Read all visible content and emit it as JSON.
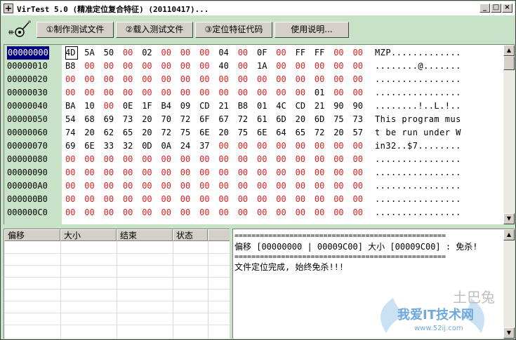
{
  "window": {
    "title": "VirTest 5.0 (精准定位复合特征) (20110417)..."
  },
  "toolbar": {
    "buttons": [
      "①制作测试文件",
      "②载入测试文件",
      "③定位特征代码",
      "使用说明..."
    ]
  },
  "hex": {
    "rows": [
      {
        "addr": "00000000",
        "bytes": [
          "4D",
          "5A",
          "50",
          "00",
          "02",
          "00",
          "00",
          "00",
          "04",
          "00",
          "0F",
          "00",
          "FF",
          "FF",
          "00",
          "00"
        ],
        "ascii": "MZP............."
      },
      {
        "addr": "00000010",
        "bytes": [
          "B8",
          "00",
          "00",
          "00",
          "00",
          "00",
          "00",
          "00",
          "40",
          "00",
          "1A",
          "00",
          "00",
          "00",
          "00",
          "00"
        ],
        "ascii": "........@......."
      },
      {
        "addr": "00000020",
        "bytes": [
          "00",
          "00",
          "00",
          "00",
          "00",
          "00",
          "00",
          "00",
          "00",
          "00",
          "00",
          "00",
          "00",
          "00",
          "00",
          "00"
        ],
        "ascii": "................"
      },
      {
        "addr": "00000030",
        "bytes": [
          "00",
          "00",
          "00",
          "00",
          "00",
          "00",
          "00",
          "00",
          "00",
          "00",
          "00",
          "00",
          "00",
          "01",
          "00",
          "00"
        ],
        "ascii": "................"
      },
      {
        "addr": "00000040",
        "bytes": [
          "BA",
          "10",
          "00",
          "0E",
          "1F",
          "B4",
          "09",
          "CD",
          "21",
          "B8",
          "01",
          "4C",
          "CD",
          "21",
          "90",
          "90"
        ],
        "ascii": "........!..L.!.."
      },
      {
        "addr": "00000050",
        "bytes": [
          "54",
          "68",
          "69",
          "73",
          "20",
          "70",
          "72",
          "6F",
          "67",
          "72",
          "61",
          "6D",
          "20",
          "6D",
          "75",
          "73"
        ],
        "ascii": "This program mus"
      },
      {
        "addr": "00000060",
        "bytes": [
          "74",
          "20",
          "62",
          "65",
          "20",
          "72",
          "75",
          "6E",
          "20",
          "75",
          "6E",
          "64",
          "65",
          "72",
          "20",
          "57"
        ],
        "ascii": "t be run under W"
      },
      {
        "addr": "00000070",
        "bytes": [
          "69",
          "6E",
          "33",
          "32",
          "0D",
          "0A",
          "24",
          "37",
          "00",
          "00",
          "00",
          "00",
          "00",
          "00",
          "00",
          "00"
        ],
        "ascii": "in32..$7........"
      },
      {
        "addr": "00000080",
        "bytes": [
          "00",
          "00",
          "00",
          "00",
          "00",
          "00",
          "00",
          "00",
          "00",
          "00",
          "00",
          "00",
          "00",
          "00",
          "00",
          "00"
        ],
        "ascii": "................"
      },
      {
        "addr": "00000090",
        "bytes": [
          "00",
          "00",
          "00",
          "00",
          "00",
          "00",
          "00",
          "00",
          "00",
          "00",
          "00",
          "00",
          "00",
          "00",
          "00",
          "00"
        ],
        "ascii": "................"
      },
      {
        "addr": "000000A0",
        "bytes": [
          "00",
          "00",
          "00",
          "00",
          "00",
          "00",
          "00",
          "00",
          "00",
          "00",
          "00",
          "00",
          "00",
          "00",
          "00",
          "00"
        ],
        "ascii": "................"
      },
      {
        "addr": "000000B0",
        "bytes": [
          "00",
          "00",
          "00",
          "00",
          "00",
          "00",
          "00",
          "00",
          "00",
          "00",
          "00",
          "00",
          "00",
          "00",
          "00",
          "00"
        ],
        "ascii": "................"
      },
      {
        "addr": "000000C0",
        "bytes": [
          "00",
          "00",
          "00",
          "00",
          "00",
          "00",
          "00",
          "00",
          "00",
          "00",
          "00",
          "00",
          "00",
          "00",
          "00",
          "00"
        ],
        "ascii": "................"
      }
    ]
  },
  "list": {
    "columns": [
      "偏移",
      "大小",
      "结束",
      "状态"
    ]
  },
  "log": {
    "lines": [
      "==================================================",
      "偏移 [00000000 | 00009C00] 大小 [00009C00] : 免杀!",
      "==================================================",
      "文件定位完成, 始终免杀!!!"
    ]
  },
  "watermark": {
    "line1": "土巴兔",
    "line2": "我爱IT技术网",
    "line3": "www.52ij.com"
  },
  "colors": {
    "zero_byte": "#e02020",
    "nonzero_byte": "#000000",
    "address_bg": "#c8e2c8",
    "selection": "#000080"
  }
}
